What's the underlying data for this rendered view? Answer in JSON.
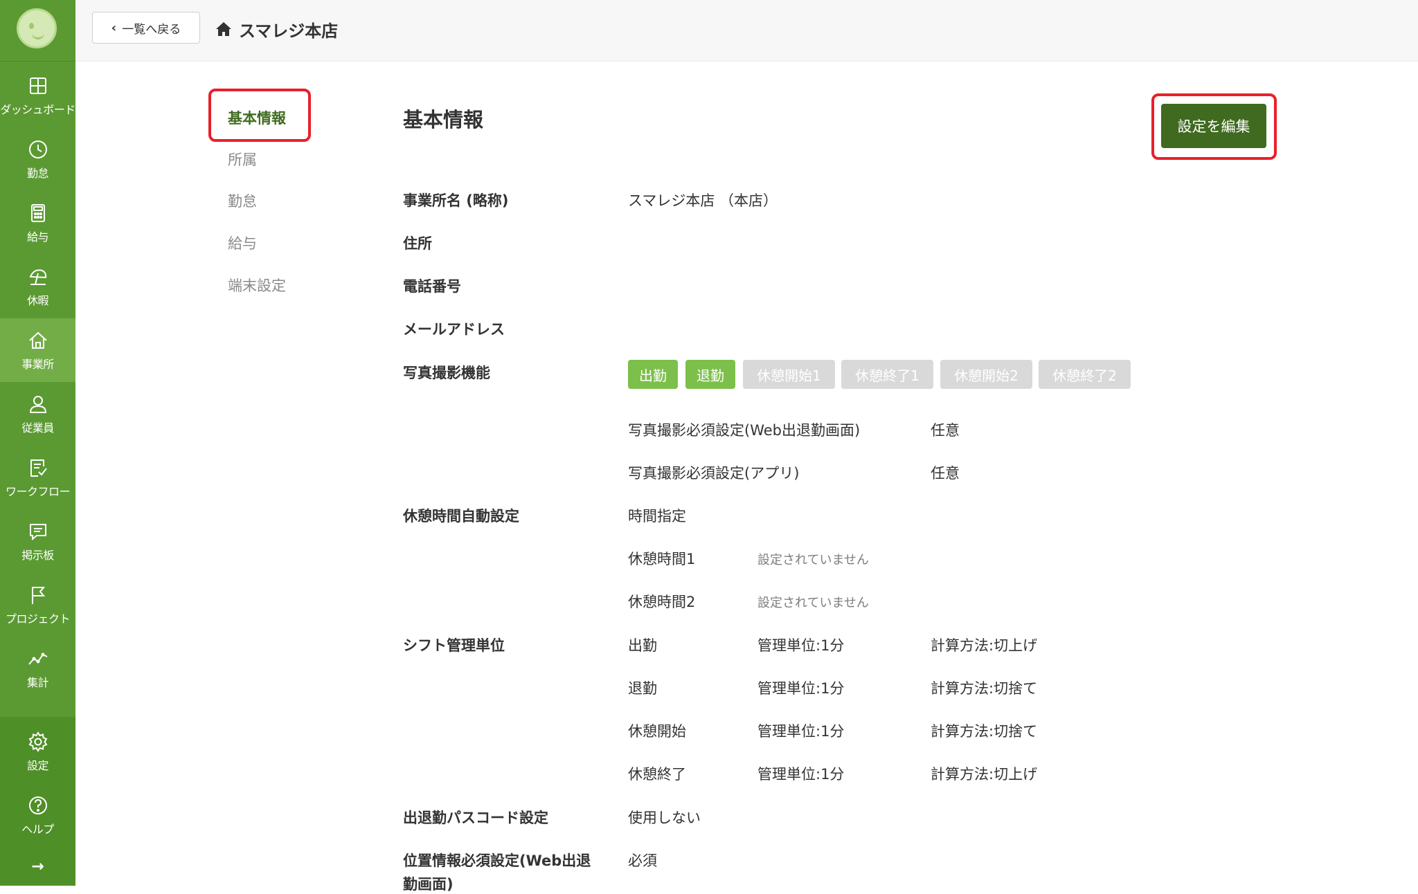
{
  "sidebar": {
    "items": [
      {
        "label": "ダッシュボード",
        "icon": "dashboard-icon"
      },
      {
        "label": "勤怠",
        "icon": "clock-icon"
      },
      {
        "label": "給与",
        "icon": "calculator-icon"
      },
      {
        "label": "休暇",
        "icon": "beach-umbrella-icon"
      },
      {
        "label": "事業所",
        "icon": "home-icon"
      },
      {
        "label": "従業員",
        "icon": "person-icon"
      },
      {
        "label": "ワークフロー",
        "icon": "checklist-icon"
      },
      {
        "label": "掲示板",
        "icon": "message-board-icon"
      },
      {
        "label": "プロジェクト",
        "icon": "flag-icon"
      },
      {
        "label": "集計",
        "icon": "line-chart-icon"
      },
      {
        "label": "設定",
        "icon": "gear-icon"
      },
      {
        "label": "ヘルプ",
        "icon": "help-icon"
      }
    ],
    "active": "事業所",
    "collapse_arrow": "→"
  },
  "header": {
    "back_label": "一覧へ戻る",
    "store_name": "スマレジ本店"
  },
  "subnav": {
    "items": [
      "基本情報",
      "所属",
      "勤怠",
      "給与",
      "端末設定"
    ],
    "active": "基本情報"
  },
  "main": {
    "title": "基本情報",
    "edit_button": "設定を編集",
    "office_name_label": "事業所名 (略称)",
    "office_name_value": "スマレジ本店 （本店）",
    "address_label": "住所",
    "phone_label": "電話番号",
    "email_label": "メールアドレス",
    "photo_label": "写真撮影機能",
    "photo_tags": [
      {
        "label": "出勤",
        "enabled": true
      },
      {
        "label": "退勤",
        "enabled": true
      },
      {
        "label": "休憩開始1",
        "enabled": false
      },
      {
        "label": "休憩終了1",
        "enabled": false
      },
      {
        "label": "休憩開始2",
        "enabled": false
      },
      {
        "label": "休憩終了2",
        "enabled": false
      }
    ],
    "photo_web_label": "写真撮影必須設定(Web出退勤画面)",
    "photo_web_value": "任意",
    "photo_app_label": "写真撮影必須設定(アプリ)",
    "photo_app_value": "任意",
    "break_auto_label": "休憩時間自動設定",
    "break_auto_value": "時間指定",
    "break1_label": "休憩時間1",
    "break1_value": "設定されていません",
    "break2_label": "休憩時間2",
    "break2_value": "設定されていません",
    "shift_label": "シフト管理単位",
    "shift_rows": [
      {
        "name": "出勤",
        "unit": "管理単位:1分",
        "method": "計算方法:切上げ"
      },
      {
        "name": "退勤",
        "unit": "管理単位:1分",
        "method": "計算方法:切捨て"
      },
      {
        "name": "休憩開始",
        "unit": "管理単位:1分",
        "method": "計算方法:切捨て"
      },
      {
        "name": "休憩終了",
        "unit": "管理単位:1分",
        "method": "計算方法:切上げ"
      }
    ],
    "passcode_label": "出退勤パスコード設定",
    "passcode_value": "使用しない",
    "location_label_line1": "位置情報必須設定(Web出退",
    "location_label_line2": "勤画面)",
    "location_value": "必須"
  },
  "colors": {
    "sidebar": "#5b9a32",
    "sidebar_active": "#73ad47",
    "accent_dark": "#3f6a1f",
    "tag_on": "#7cc04b",
    "tag_off": "#d9d9d9",
    "highlight": "#e8202a"
  }
}
